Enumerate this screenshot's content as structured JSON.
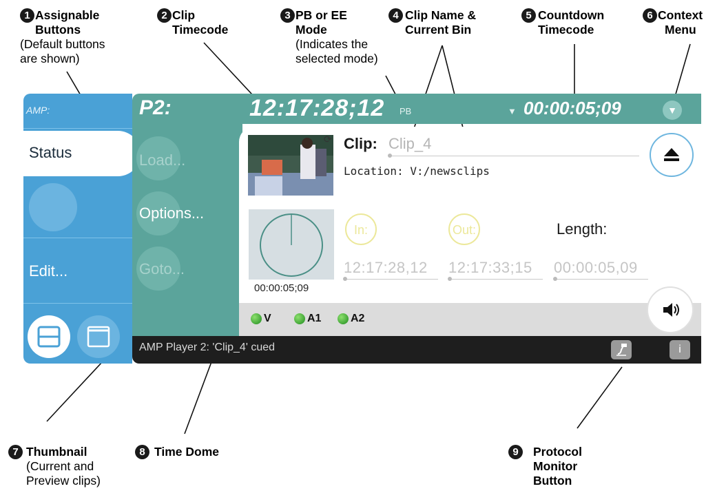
{
  "callouts": {
    "c1": {
      "num": "1",
      "title1": "Assignable",
      "title2": "Buttons",
      "sub1": "(Default buttons",
      "sub2": "are shown)"
    },
    "c2": {
      "num": "2",
      "title1": "Clip",
      "title2": "Timecode"
    },
    "c3": {
      "num": "3",
      "title1": "PB or EE",
      "title2": "Mode",
      "sub1": "(Indicates the",
      "sub2": "selected mode)"
    },
    "c4": {
      "num": "4",
      "title1": "Clip Name &",
      "title2": "Current Bin"
    },
    "c5": {
      "num": "5",
      "title1": "Countdown",
      "title2": "Timecode"
    },
    "c6": {
      "num": "6",
      "title1": "Context",
      "title2": "Menu"
    },
    "c7": {
      "num": "7",
      "title1": "Thumbnail",
      "sub1": "(Current and",
      "sub2": "Preview clips)"
    },
    "c8": {
      "num": "8",
      "title1": "Time Dome"
    },
    "c9": {
      "num": "9",
      "title1": "Protocol",
      "title2": "Monitor",
      "title3": "Button"
    }
  },
  "sidebar": {
    "app_label": "AMP:",
    "status_tab": "Status",
    "edit_label": "Edit..."
  },
  "header": {
    "channel": "P2:",
    "clip_timecode": "12:17:28;12",
    "mode": "PB",
    "countdown_arrow": "▼",
    "countdown_timecode": "00:00:05;09",
    "context_icon": "▼"
  },
  "assignable_buttons": {
    "load": "Load...",
    "options": "Options...",
    "goto": "Goto..."
  },
  "clip": {
    "label": "Clip:",
    "name": "Clip_4",
    "location_label": "Location:",
    "location": "V:/newsclips"
  },
  "time_dome": {
    "time": "00:00:05;09"
  },
  "marks": {
    "in_label": "In:",
    "out_label": "Out:",
    "length_label": "Length:",
    "in_tc": "12:17:28,12",
    "out_tc": "12:17:33;15",
    "length_tc": "00:00:05,09"
  },
  "tracks": [
    "V",
    "A1",
    "A2"
  ],
  "status_bar": {
    "message": "AMP Player 2: 'Clip_4' cued",
    "protocol_icon": "protocol-monitor-icon",
    "info_icon": "i"
  },
  "colors": {
    "accent_blue": "#4aa1d6",
    "header_teal": "#5ba49b",
    "led_green": "#2ea82e"
  }
}
